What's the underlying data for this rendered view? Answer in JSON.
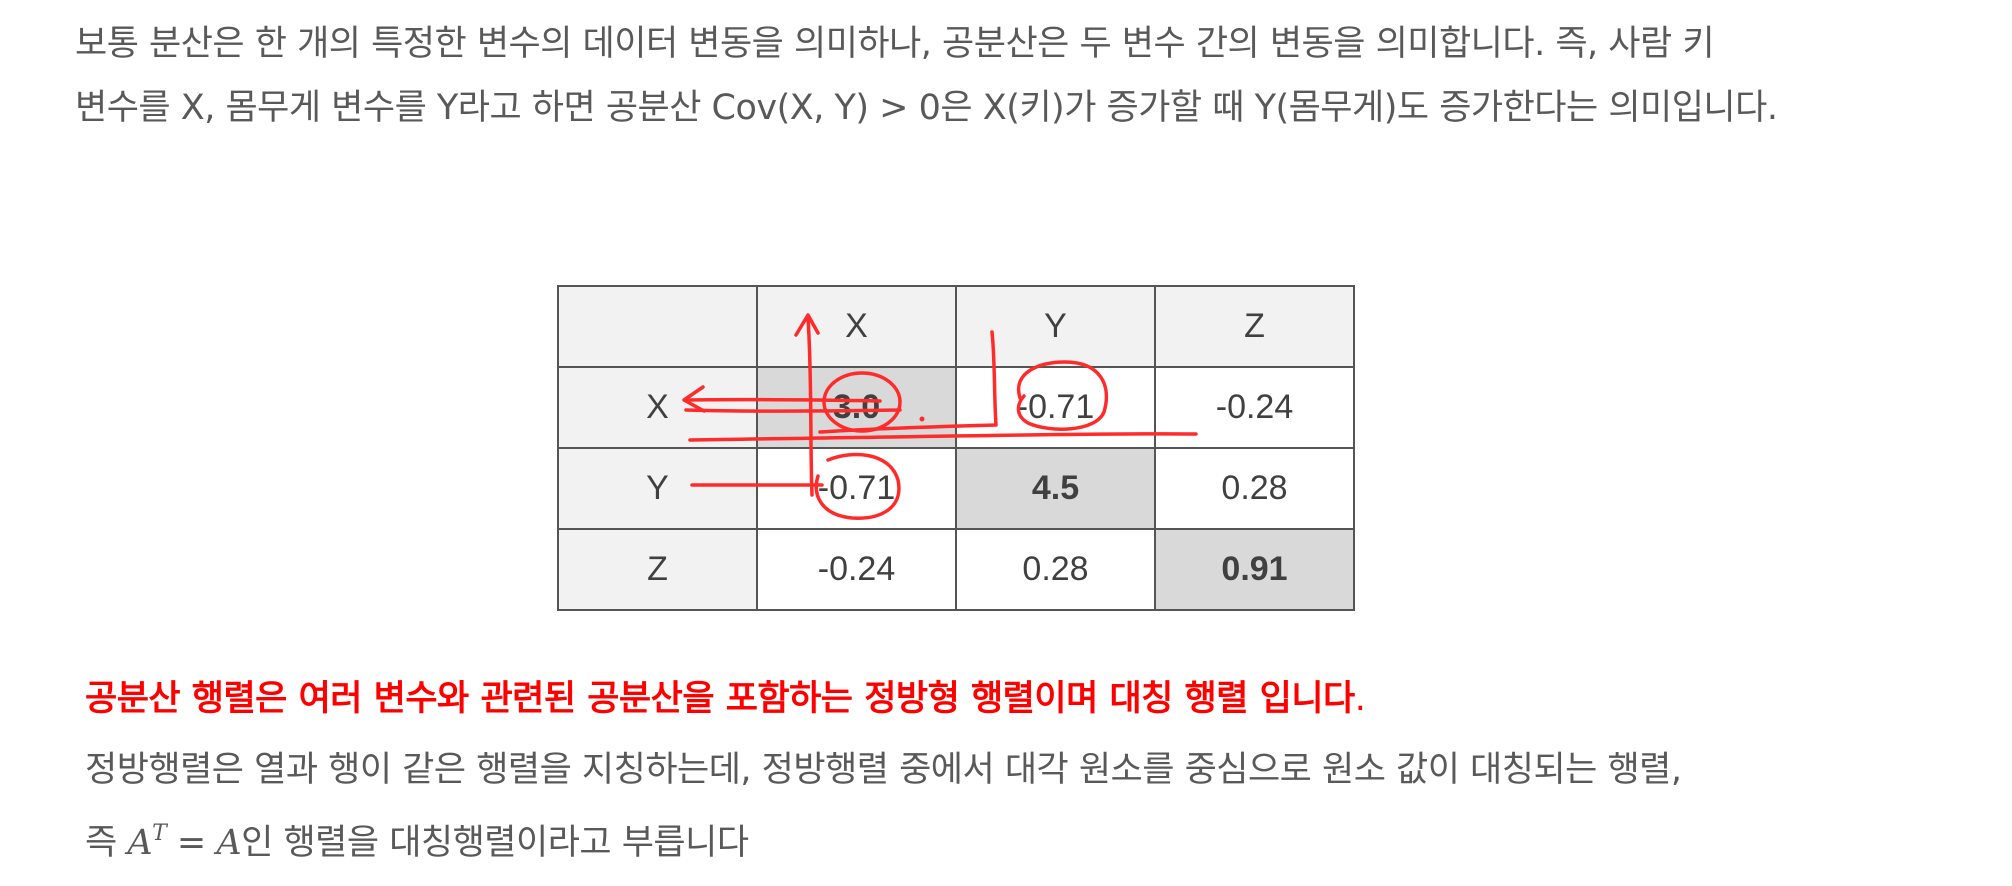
{
  "intro": {
    "line1": "보통 분산은 한 개의 특정한 변수의 데이터 변동을 의미하나, 공분산은 두 변수 간의 변동을 의미합니다. 즉, 사람 키",
    "line2": "변수를 X, 몸무게 변수를 Y라고 하면 공분산 Cov(X, Y) > 0은 X(키)가 증가할 때 Y(몸무게)도 증가한다는 의미입니다."
  },
  "matrix": {
    "header": [
      "",
      "X",
      "Y",
      "Z"
    ],
    "rows": [
      {
        "label": "X",
        "values": [
          "3.0",
          "-0.71",
          "-0.24"
        ]
      },
      {
        "label": "Y",
        "values": [
          "-0.71",
          "4.5",
          "0.28"
        ]
      },
      {
        "label": "Z",
        "values": [
          "-0.24",
          "0.28",
          "0.91"
        ]
      }
    ]
  },
  "highlight": {
    "text": "공분산 행렬은 여러 변수와 관련된 공분산을 포함하는 정방형 행렬이며 대칭 행렬 입니다",
    "end": "."
  },
  "explanation": {
    "line1": "정방행렬은 열과 행이 같은 행렬을 지칭하는데, 정방행렬 중에서 대각 원소를 중심으로 원소 값이 대칭되는 행렬,",
    "line2_prefix": "즉 ",
    "math_base": "A",
    "math_sup": "T",
    "math_eq": " = ",
    "math_rhs": "A",
    "line2_suffix": "인 행렬을 대칭행렬이라고 부릅니다"
  },
  "colors": {
    "text": "#595959",
    "accent_red": "#ff0000",
    "header_bg": "#f2f2f2",
    "diagonal_bg": "#d9d9d9",
    "annotation": "#ff2a2a"
  }
}
